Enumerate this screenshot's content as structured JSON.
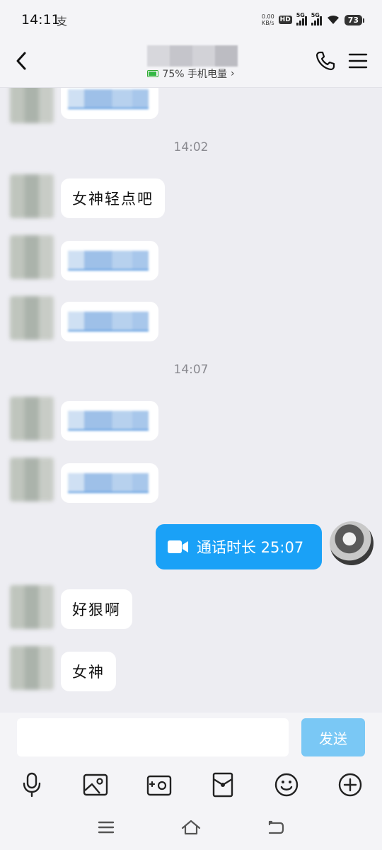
{
  "status_bar": {
    "time": "14:11",
    "extra_icon": "支",
    "net_speed_value": "0.00",
    "net_speed_unit": "KB/s",
    "hd_label": "HD",
    "sim1_label": "5G",
    "sim2_label": "5G",
    "battery_level": "73"
  },
  "header": {
    "back_icon": "chevron-left-icon",
    "device_battery_text": "75% 手机电量",
    "device_status_arrow": "›",
    "phone_icon": "phone-icon",
    "menu_icon": "menu-icon"
  },
  "chat": {
    "timestamps": [
      "14:02",
      "14:07"
    ],
    "messages": [
      {
        "text": "女神轻点吧"
      },
      {
        "text": "好狠啊"
      },
      {
        "text": "女神"
      }
    ],
    "call_message": {
      "icon": "video-camera-icon",
      "text": "通话时长 25:07"
    }
  },
  "input": {
    "placeholder": "",
    "send_label": "发送"
  },
  "toolbar": [
    "microphone-icon",
    "image-icon",
    "camera-icon",
    "red-envelope-icon",
    "emoji-icon",
    "plus-circle-icon"
  ],
  "navbar": [
    "menu-lines-icon",
    "home-icon",
    "back-arrow-icon"
  ],
  "colors": {
    "accent": "#1AA1F7",
    "send_button": "#7AC8F5",
    "chat_background": "#EDEDF2",
    "battery_green": "#33B844"
  }
}
